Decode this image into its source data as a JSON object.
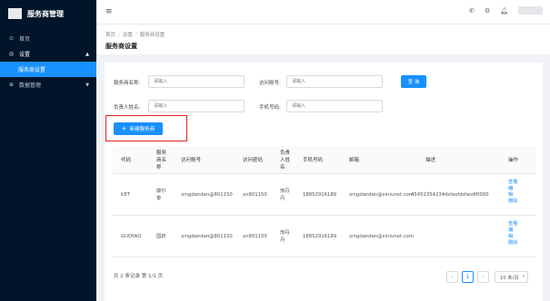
{
  "app": {
    "title": "服务商管理"
  },
  "sidebar": {
    "items": [
      {
        "label": "首页",
        "icon": "home-icon",
        "glyph": "⊙"
      },
      {
        "label": "设置",
        "icon": "settings-icon",
        "glyph": "◎",
        "chevron": "▲"
      },
      {
        "label": "服务商设置"
      },
      {
        "label": "数据管理",
        "icon": "data-icon",
        "glyph": "⊕",
        "chevron": "▼"
      }
    ]
  },
  "topbar": {
    "menu_icon": "≡",
    "phone_icon": "✆",
    "settings_icon": "⚙",
    "bell_icon": "🔔︎"
  },
  "breadcrumb": [
    "首页",
    "设置",
    "服务商设置"
  ],
  "breadcrumb_sep": "/",
  "page_title": "服务商设置",
  "search": {
    "name_label": "服务商名称:",
    "account_label": "访问账号:",
    "contact_label": "负责人姓名:",
    "phone_label": "手机号码:",
    "placeholder": "请输入",
    "search_button": "查 询"
  },
  "new_button": {
    "plus": "+",
    "label": "新建服务商"
  },
  "table": {
    "headers": {
      "code": "代码",
      "name": [
        "服务",
        "商名",
        "称"
      ],
      "account": "访问账号",
      "password": "访问密码",
      "contact": [
        "负责",
        "人姓",
        "名"
      ],
      "phone": "手机号码",
      "email": "邮箱",
      "desc": "描述",
      "op": "操作"
    },
    "rows": [
      {
        "code": "KET",
        "name": [
          "康尔",
          "泰"
        ],
        "account": "xingdandan@801150",
        "password": "xn801150",
        "contact": [
          "邢丹",
          "丹"
        ],
        "phone": "18852916189",
        "email": "xingdandan@xiniunet.com",
        "desc": "45452354234dsfasfdsfasdf0000",
        "ops": [
          "查看",
          "编",
          "辑",
          "删除"
        ]
      },
      {
        "code": "GUOYAO",
        "name": [
          "国药"
        ],
        "account": "xingdandan@801150",
        "password": "xn801150",
        "contact": [
          "邢丹",
          "丹"
        ],
        "phone": "18852916189",
        "email": "xingdandan@xiniunet.com",
        "desc": "",
        "ops": [
          "查看",
          "编",
          "辑",
          "删除"
        ]
      }
    ]
  },
  "pagination": {
    "summary": "共 2 条记录 第 1/1 页",
    "prev": "‹",
    "current": "1",
    "next": "›",
    "page_size": "10 条/页",
    "page_size_chevron": "▾"
  },
  "colors": {
    "primary": "#1890ff",
    "sidebar_bg": "#001529",
    "highlight": "#e02020"
  }
}
